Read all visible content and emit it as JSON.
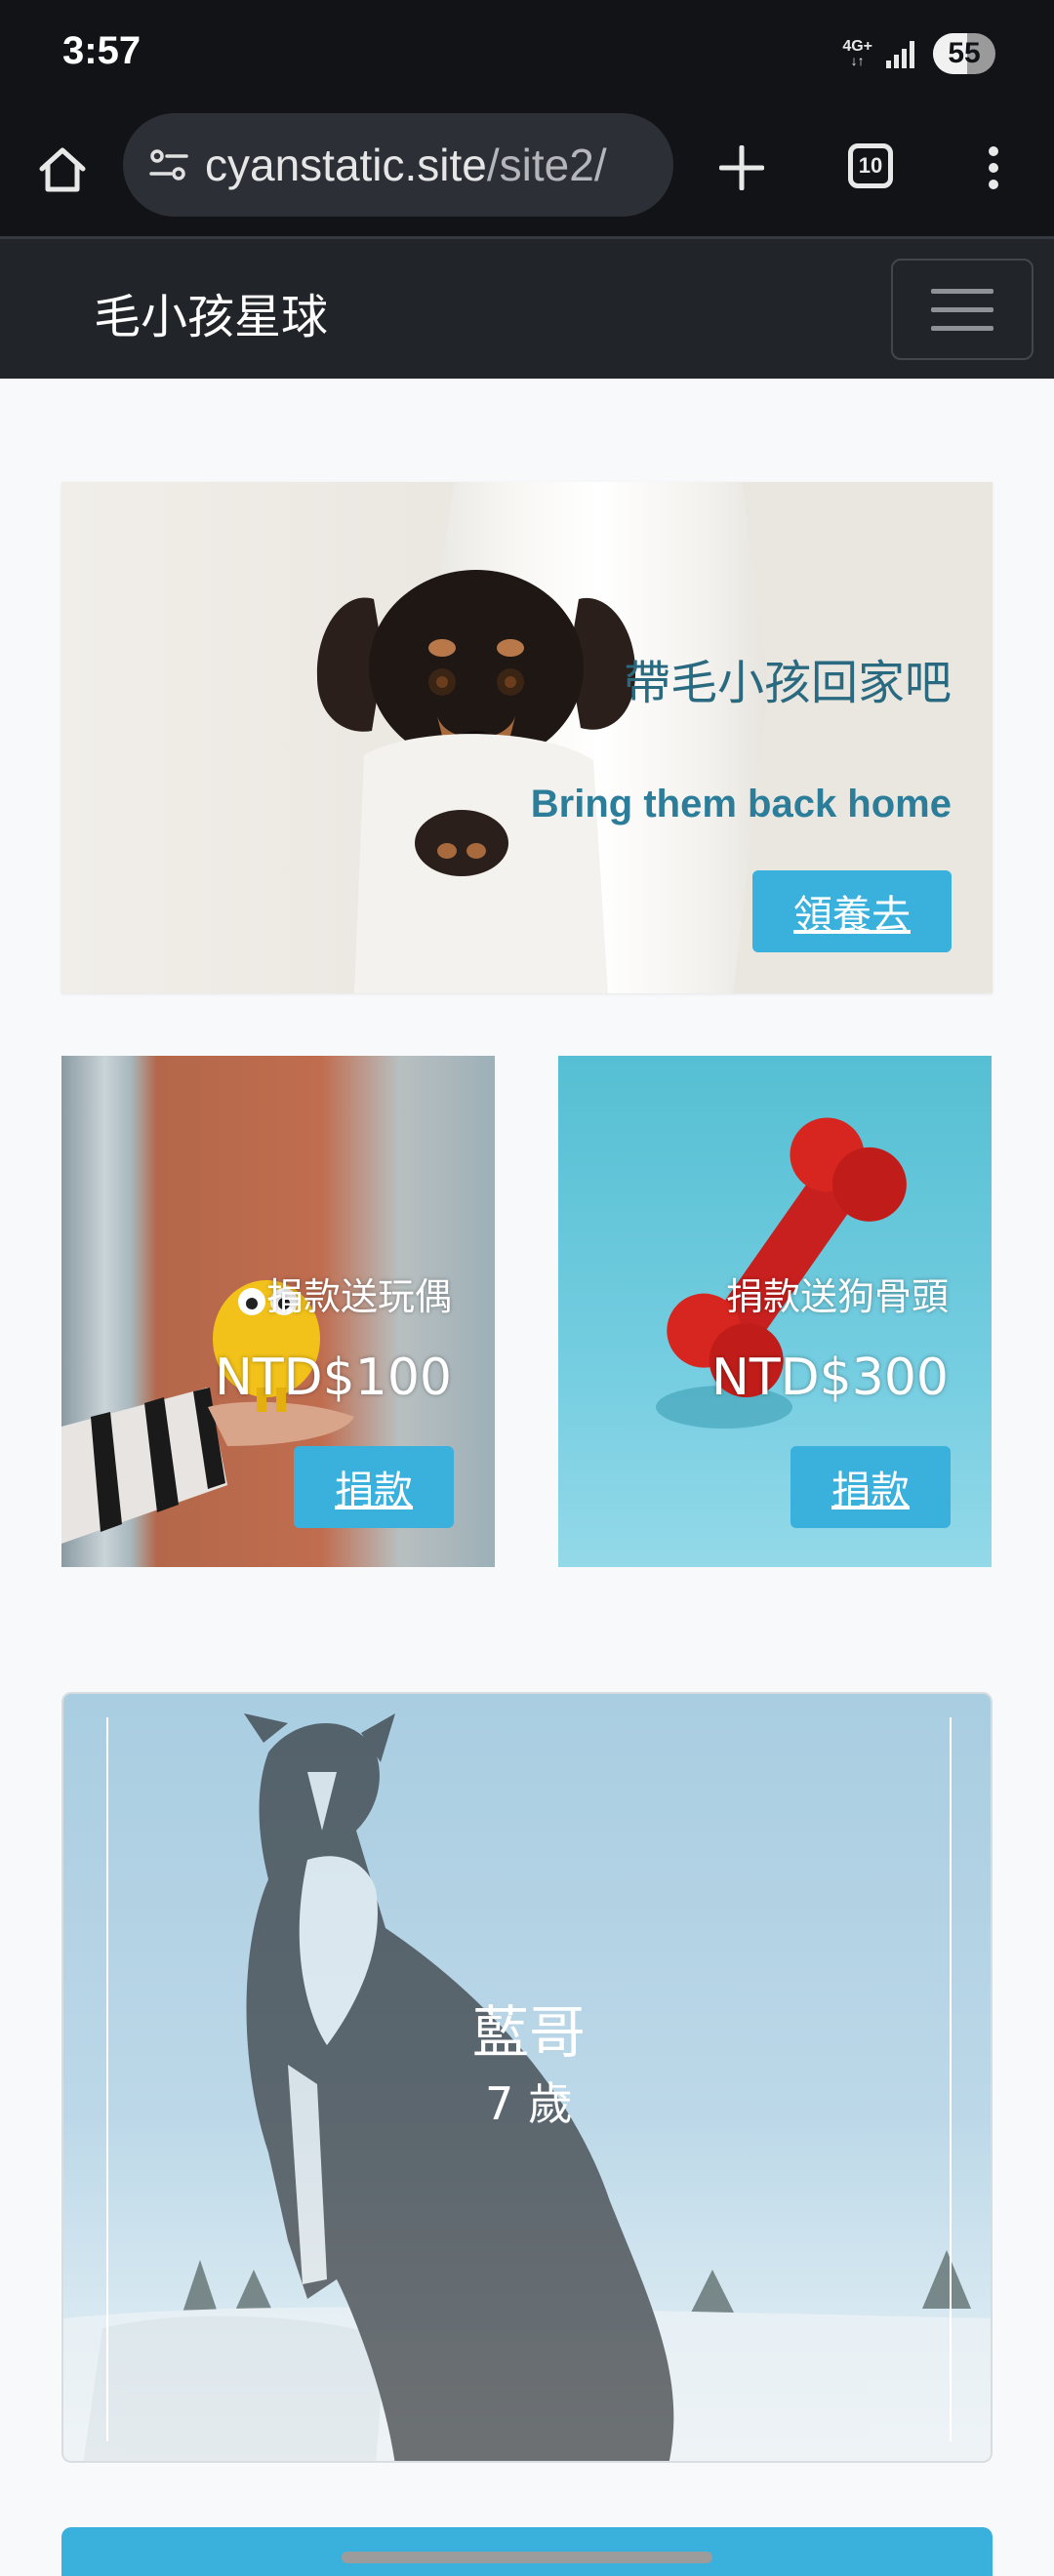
{
  "status_bar": {
    "time": "3:57",
    "network": "4G+",
    "battery_level": "55",
    "battery_fraction": 0.55
  },
  "browser": {
    "url_domain": "cyanstatic.site",
    "url_path": "/site2/",
    "tab_count": "10"
  },
  "site": {
    "brand": "毛小孩星球"
  },
  "hero": {
    "title": "帶毛小孩回家吧",
    "subtitle": "Bring them back home",
    "button": "領養去"
  },
  "gifts": [
    {
      "label": "捐款送玩偶",
      "price": "NTD$100",
      "button": "捐款"
    },
    {
      "label": "捐款送狗骨頭",
      "price": "NTD$300",
      "button": "捐款"
    }
  ],
  "pet": {
    "name": "藍哥",
    "age": "7 歲"
  },
  "colors": {
    "accent": "#3ab0dd",
    "navbar": "#212529",
    "browser": "#121317",
    "hero_text": "#2a6a80"
  },
  "icons": {
    "home": "home-icon",
    "site_info": "tune-icon",
    "new_tab": "plus-icon",
    "tabs": "tab-switcher-icon",
    "menu": "kebab-menu-icon",
    "nav_toggle": "hamburger-icon"
  }
}
